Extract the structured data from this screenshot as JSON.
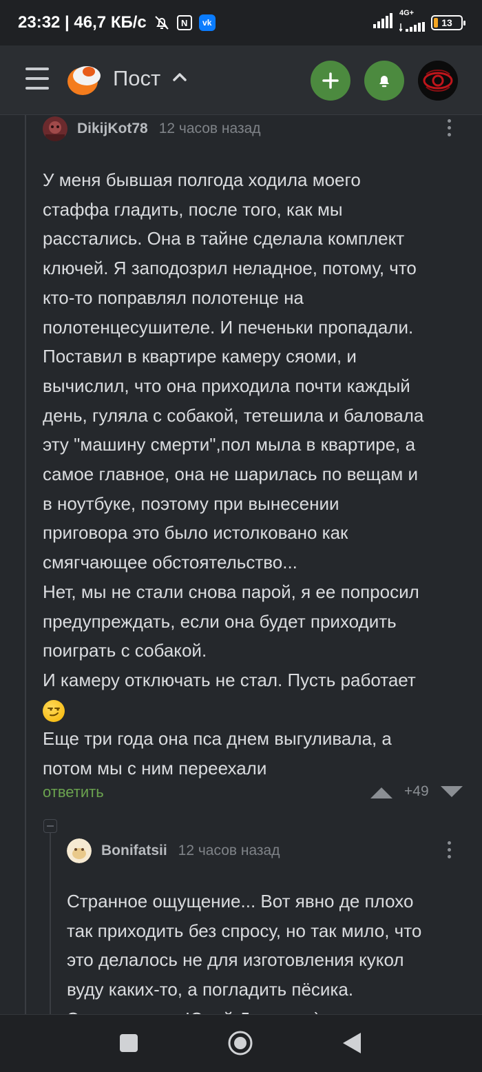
{
  "status_bar": {
    "time_speed": "23:32 | 46,7 КБ/с",
    "network": "4G+",
    "battery": "13"
  },
  "header": {
    "title": "Пост"
  },
  "comments": [
    {
      "author": "DikijKot78",
      "time": "12 часов назад",
      "lines": [
        "У меня бывшая полгода ходила моего",
        "стаффа гладить, после того, как мы",
        "расстались. Она в тайне сделала комплект",
        "ключей. Я заподозрил неладное, потому, что",
        "кто-то поправлял полотенце на",
        "полотенцесушителе. И печеньки пропадали.",
        "Поставил в квартире камеру сяоми, и",
        "вычислил, что она приходила почти каждый",
        "день, гуляла с собакой, тетешила и баловала",
        "эту \"машину смерти\",пол мыла в квартире, а",
        "самое главное, она не шарилась по вещам и",
        "в ноутбуке, поэтому при вынесении",
        "приговора это было истолковано как",
        "смягчающее обстоятельство...",
        "Нет, мы не стали снова парой, я ее попросил",
        "предупреждать, если она будет приходить",
        "поиграть с собакой.",
        "И камеру отключать не стал. Пусть работает",
        "",
        "Еще три года она пса днем выгуливала, а",
        "потом мы с ним переехали"
      ],
      "reply_label": "ответить",
      "score": "+49"
    },
    {
      "author": "Bonifatsii",
      "time": "12 часов назад",
      "lines": [
        "Странное ощущение... Вот явно де плохо",
        "так приходить без спросу, но так мило, что",
        "это делалось не для изготовления кукол",
        "вуду каких-то, а погладить пёсика.",
        "Это почти как Юрий Деточкин)"
      ]
    }
  ],
  "colors": {
    "background": "#25282c",
    "accent_green": "#4c8a3f",
    "reply_green": "#6ba34f"
  }
}
